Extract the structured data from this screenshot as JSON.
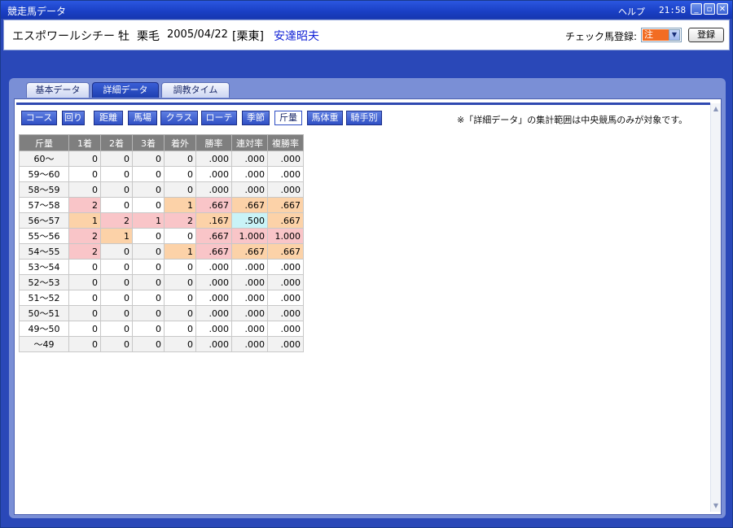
{
  "window": {
    "title": "競走馬データ",
    "help_label": "ヘルプ",
    "clock": "21:58",
    "controls": {
      "minimize": "_",
      "restore": "▫",
      "close": "✕"
    }
  },
  "horse": {
    "name": "エスポワールシチー",
    "sex": "牡",
    "coat": "栗毛",
    "birth_date": "2005/04/22",
    "stable": "[栗東]",
    "trainer": "安達昭夫"
  },
  "check": {
    "label": "チェック馬登録:",
    "selected": "注",
    "register_label": "登録"
  },
  "tabs": [
    {
      "label": "基本データ",
      "active": false
    },
    {
      "label": "詳細データ",
      "active": true
    },
    {
      "label": "調教タイム",
      "active": false
    }
  ],
  "filters": [
    {
      "label": "コース",
      "active": false
    },
    {
      "label": "回り",
      "active": false
    },
    {
      "label": "距離",
      "active": false
    },
    {
      "label": "馬場",
      "active": false
    },
    {
      "label": "クラス",
      "active": false
    },
    {
      "label": "ローテ",
      "active": false
    },
    {
      "label": "季節",
      "active": false
    },
    {
      "label": "斤量",
      "active": true
    },
    {
      "label": "馬体重",
      "active": false
    },
    {
      "label": "騎手別",
      "active": false
    }
  ],
  "note": "※「詳細データ」の集計範囲は中央競馬のみが対象です。",
  "table": {
    "headers": [
      "斤量",
      "1着",
      "2着",
      "3着",
      "着外",
      "勝率",
      "連対率",
      "複勝率"
    ],
    "rows": [
      [
        "60～",
        "0",
        "0",
        "0",
        "0",
        ".000",
        ".000",
        ".000"
      ],
      [
        "59～60",
        "0",
        "0",
        "0",
        "0",
        ".000",
        ".000",
        ".000"
      ],
      [
        "58～59",
        "0",
        "0",
        "0",
        "0",
        ".000",
        ".000",
        ".000"
      ],
      [
        "57～58",
        "2",
        "0",
        "0",
        "1",
        ".667",
        ".667",
        ".667"
      ],
      [
        "56～57",
        "1",
        "2",
        "1",
        "2",
        ".167",
        ".500",
        ".667"
      ],
      [
        "55～56",
        "2",
        "1",
        "0",
        "0",
        ".667",
        "1.000",
        "1.000"
      ],
      [
        "54～55",
        "2",
        "0",
        "0",
        "1",
        ".667",
        ".667",
        ".667"
      ],
      [
        "53～54",
        "0",
        "0",
        "0",
        "0",
        ".000",
        ".000",
        ".000"
      ],
      [
        "52～53",
        "0",
        "0",
        "0",
        "0",
        ".000",
        ".000",
        ".000"
      ],
      [
        "51～52",
        "0",
        "0",
        "0",
        "0",
        ".000",
        ".000",
        ".000"
      ],
      [
        "50～51",
        "0",
        "0",
        "0",
        "0",
        ".000",
        ".000",
        ".000"
      ],
      [
        "49～50",
        "0",
        "0",
        "0",
        "0",
        ".000",
        ".000",
        ".000"
      ],
      [
        "～49",
        "0",
        "0",
        "0",
        "0",
        ".000",
        ".000",
        ".000"
      ]
    ],
    "highlights": [
      {
        "row": 3,
        "col": 1,
        "color": "pink"
      },
      {
        "row": 3,
        "col": 4,
        "color": "orange"
      },
      {
        "row": 3,
        "col": 5,
        "color": "pink"
      },
      {
        "row": 3,
        "col": 6,
        "color": "orange"
      },
      {
        "row": 3,
        "col": 7,
        "color": "orange"
      },
      {
        "row": 4,
        "col": 1,
        "color": "orange"
      },
      {
        "row": 4,
        "col": 2,
        "color": "pink"
      },
      {
        "row": 4,
        "col": 3,
        "color": "pink"
      },
      {
        "row": 4,
        "col": 4,
        "color": "pink"
      },
      {
        "row": 4,
        "col": 5,
        "color": "orange"
      },
      {
        "row": 4,
        "col": 6,
        "color": "cyan"
      },
      {
        "row": 4,
        "col": 7,
        "color": "orange"
      },
      {
        "row": 5,
        "col": 1,
        "color": "pink"
      },
      {
        "row": 5,
        "col": 2,
        "color": "orange"
      },
      {
        "row": 5,
        "col": 5,
        "color": "pink"
      },
      {
        "row": 5,
        "col": 6,
        "color": "pink"
      },
      {
        "row": 5,
        "col": 7,
        "color": "pink"
      },
      {
        "row": 6,
        "col": 1,
        "color": "pink"
      },
      {
        "row": 6,
        "col": 4,
        "color": "orange"
      },
      {
        "row": 6,
        "col": 5,
        "color": "pink"
      },
      {
        "row": 6,
        "col": 6,
        "color": "orange"
      },
      {
        "row": 6,
        "col": 7,
        "color": "orange"
      }
    ]
  },
  "colors": {
    "accent": "#2f4fc4",
    "highlight_pink": "#f9c5c8",
    "highlight_orange": "#fcd2a8",
    "highlight_cyan": "#c9f3f7"
  }
}
